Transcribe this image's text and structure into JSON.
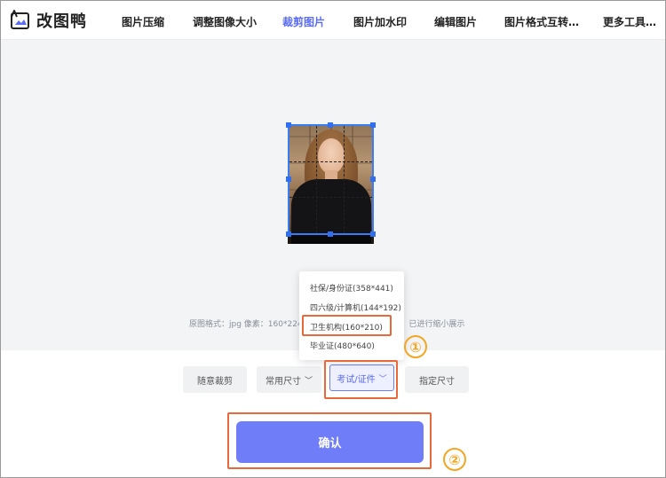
{
  "app": {
    "name": "改图鸭"
  },
  "nav": {
    "items": [
      {
        "label": "图片压缩"
      },
      {
        "label": "调整图像大小"
      },
      {
        "label": "裁剪图片"
      },
      {
        "label": "图片加水印"
      },
      {
        "label": "编辑图片"
      },
      {
        "label": "图片格式互转…"
      },
      {
        "label": "更多工具…"
      }
    ],
    "active_index": 2
  },
  "image_info": {
    "text": "原图格式：jpg   像素：160*224",
    "text_tail": "作，已进行缩小展示"
  },
  "dropdown": {
    "items": [
      {
        "label": "社保/身份证(358*441)"
      },
      {
        "label": "四六级/计算机(144*192)"
      },
      {
        "label": "卫生机构(160*210)"
      },
      {
        "label": "毕业证(480*640)"
      }
    ],
    "highlighted_index": 2
  },
  "toolbar": {
    "free_crop": "随意裁剪",
    "common_size": "常用尺寸",
    "exam_id": "考试/证件",
    "custom_size": "指定尺寸"
  },
  "confirm": {
    "label": "确认"
  },
  "annotations": {
    "step1": "①",
    "step2": "②"
  },
  "colors": {
    "accent": "#5b6cf7",
    "confirm_bg": "#6f7df9",
    "highlight": "#e8683a",
    "step_marker": "#f5a623",
    "crop_border": "#3a7bf7"
  }
}
